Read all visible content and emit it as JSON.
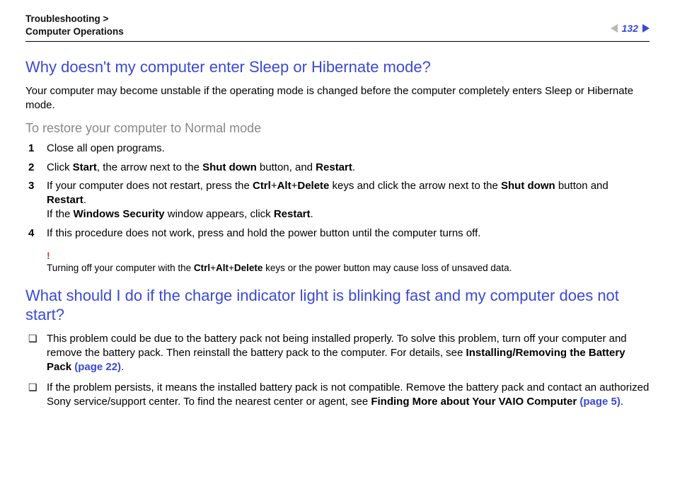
{
  "header": {
    "breadcrumb_line1": "Troubleshooting >",
    "breadcrumb_line2": "Computer Operations",
    "page_number": "132"
  },
  "section1": {
    "title": "Why doesn't my computer enter Sleep or Hibernate mode?",
    "intro": "Your computer may become unstable if the operating mode is changed before the computer completely enters Sleep or Hibernate mode.",
    "subhead": "To restore your computer to Normal mode",
    "steps": {
      "s1": "Close all open programs.",
      "s2_a": "Click ",
      "s2_b": "Start",
      "s2_c": ", the arrow next to the ",
      "s2_d": "Shut down",
      "s2_e": " button, and ",
      "s2_f": "Restart",
      "s2_g": ".",
      "s3_a": "If your computer does not restart, press the ",
      "s3_b": "Ctrl",
      "s3_c": "+",
      "s3_d": "Alt",
      "s3_e": "+",
      "s3_f": "Delete",
      "s3_g": " keys and click the arrow next to the ",
      "s3_h": "Shut down",
      "s3_i": " button and ",
      "s3_j": "Restart",
      "s3_k": ".",
      "s3_l": "If the ",
      "s3_m": "Windows Security",
      "s3_n": " window appears, click ",
      "s3_o": "Restart",
      "s3_p": ".",
      "s4": "If this procedure does not work, press and hold the power button until the computer turns off."
    },
    "warning": {
      "bang": "!",
      "t1": "Turning off your computer with the ",
      "t2": "Ctrl",
      "t3": "+",
      "t4": "Alt",
      "t5": "+",
      "t6": "Delete",
      "t7": " keys or the power button may cause loss of unsaved data."
    }
  },
  "section2": {
    "title": "What should I do if the charge indicator light is blinking fast and my computer does not start?",
    "b1_a": "This problem could be due to the battery pack not being installed properly. To solve this problem, turn off your computer and remove the battery pack. Then reinstall the battery pack to the computer. For details, see ",
    "b1_b": "Installing/Removing the Battery Pack ",
    "b1_c": "(page 22)",
    "b1_d": ".",
    "b2_a": "If the problem persists, it means the installed battery pack is not compatible. Remove the battery pack and contact an authorized Sony service/support center. To find the nearest center or agent, see ",
    "b2_b": "Finding More about Your VAIO Computer ",
    "b2_c": "(page 5)",
    "b2_d": "."
  }
}
